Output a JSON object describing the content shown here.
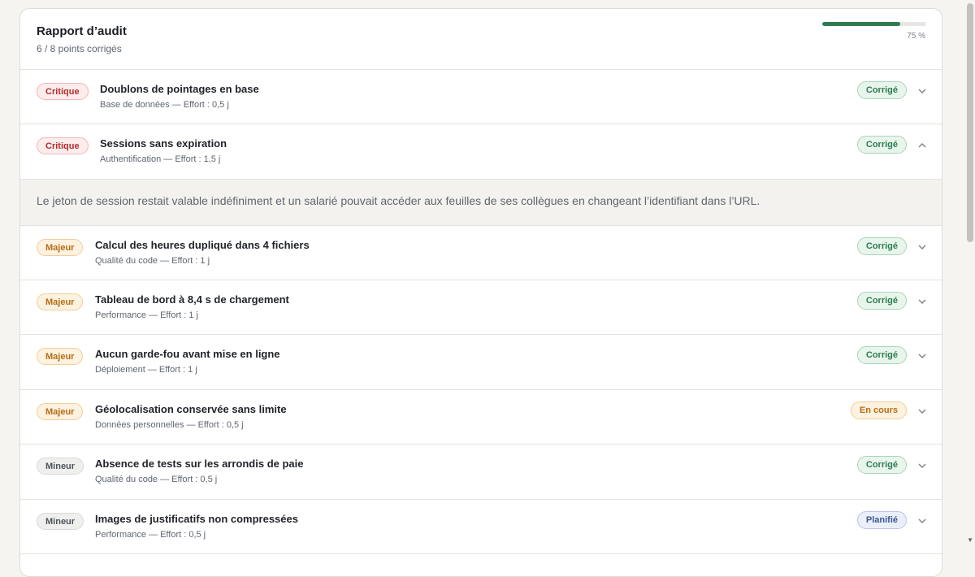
{
  "header": {
    "title": "Rapport d’audit",
    "subtitle": "6 / 8 points corrigés",
    "progress_percent": 75,
    "progress_label": "75 %"
  },
  "expanded_detail": "Le jeton de session restait valable indéfiniment et un salarié pouvait accéder aux feuilles de ses collègues en changeant l’identifiant dans l’URL.",
  "items": [
    {
      "severity": "Critique",
      "title": "Doublons de pointages en base",
      "meta": "Base de données — Effort : 0,5 j",
      "status": "Corrigé"
    },
    {
      "severity": "Critique",
      "title": "Sessions sans expiration",
      "meta": "Authentification — Effort : 1,5 j",
      "status": "Corrigé"
    },
    {
      "severity": "Majeur",
      "title": "Calcul des heures dupliqué dans 4 fichiers",
      "meta": "Qualité du code — Effort : 1 j",
      "status": "Corrigé"
    },
    {
      "severity": "Majeur",
      "title": "Tableau de bord à 8,4 s de chargement",
      "meta": "Performance — Effort : 1 j",
      "status": "Corrigé"
    },
    {
      "severity": "Majeur",
      "title": "Aucun garde-fou avant mise en ligne",
      "meta": "Déploiement — Effort : 1 j",
      "status": "Corrigé"
    },
    {
      "severity": "Majeur",
      "title": "Géolocalisation conservée sans limite",
      "meta": "Données personnelles — Effort : 0,5 j",
      "status": "En cours"
    },
    {
      "severity": "Mineur",
      "title": "Absence de tests sur les arrondis de paie",
      "meta": "Qualité du code — Effort : 0,5 j",
      "status": "Corrigé"
    },
    {
      "severity": "Mineur",
      "title": "Images de justificatifs non compressées",
      "meta": "Performance — Effort : 0,5 j",
      "status": "Planifié"
    }
  ],
  "colors": {
    "progress": "#2e7d4f",
    "critique": "#b42d2d",
    "majeur": "#b66e12",
    "corrige": "#2e7d4f",
    "planifie": "#3a5693"
  }
}
